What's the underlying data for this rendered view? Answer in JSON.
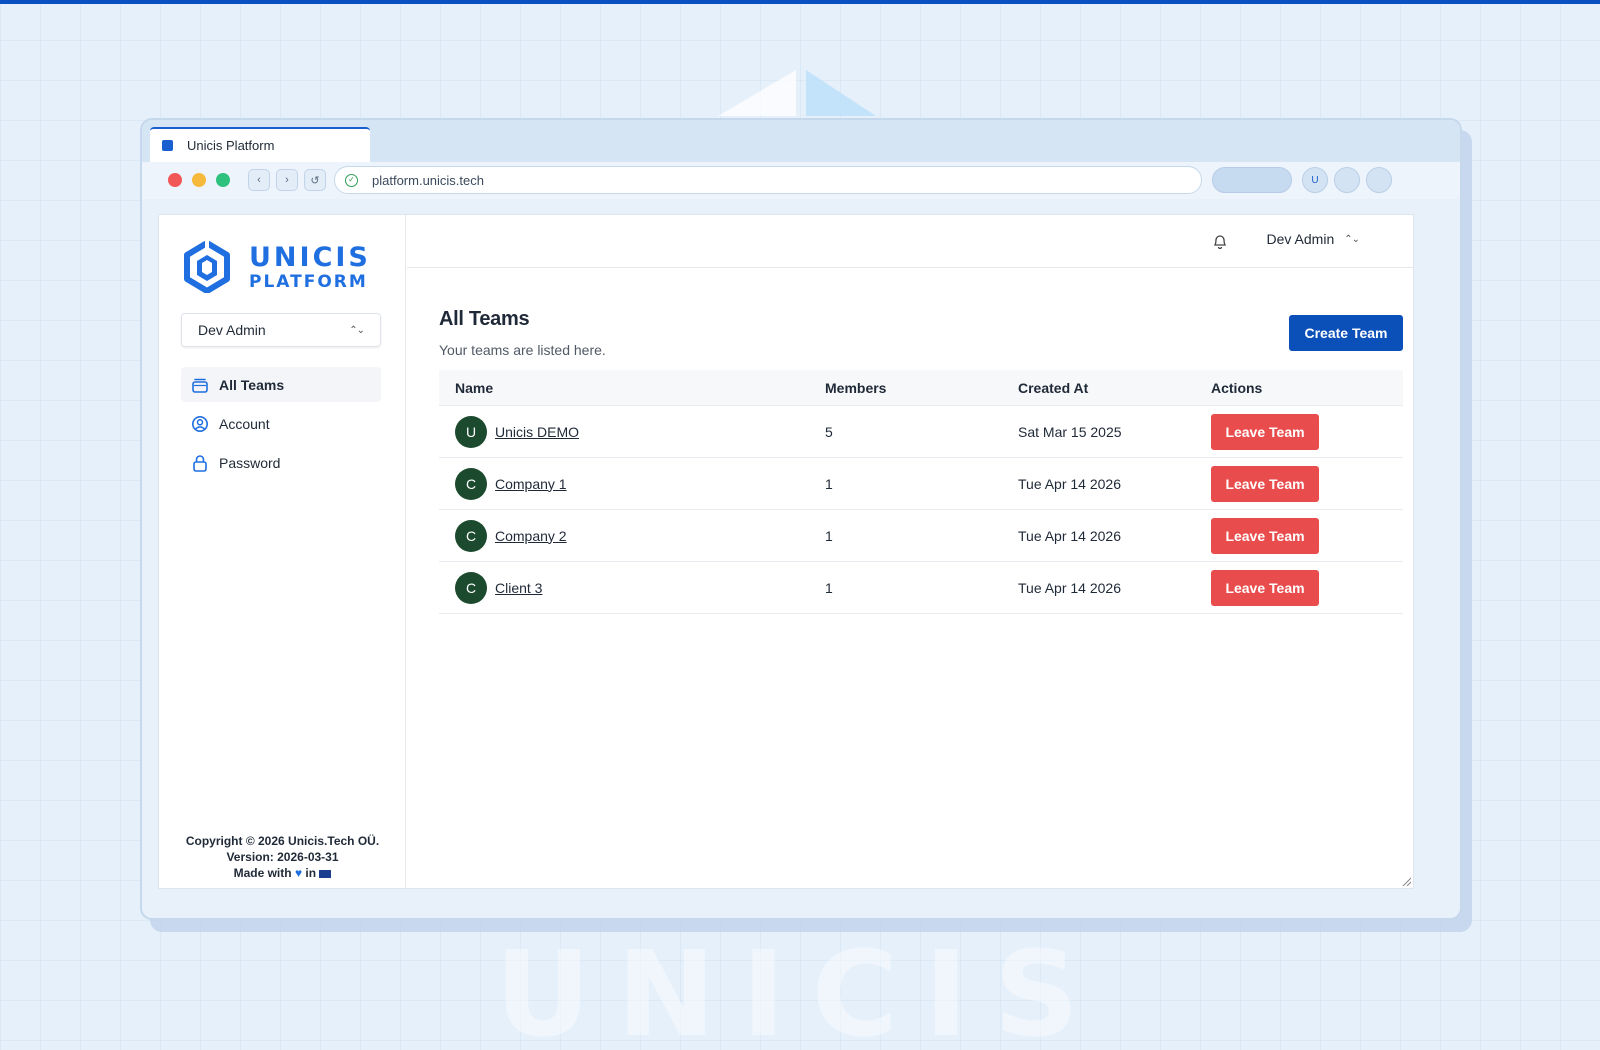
{
  "browser": {
    "tab_title": "Unicis Platform",
    "url": "platform.unicis.tech",
    "profile_initial": "U"
  },
  "watermark": "UNICIS",
  "sidebar": {
    "logo_line1": "UNICIS",
    "logo_line2": "PLATFORM",
    "user_select": "Dev Admin",
    "nav": [
      {
        "label": "All Teams",
        "icon": "teams-icon",
        "active": true
      },
      {
        "label": "Account",
        "icon": "user-circle-icon",
        "active": false
      },
      {
        "label": "Password",
        "icon": "lock-icon",
        "active": false
      }
    ],
    "footer": {
      "copyright": "Copyright © 2026 Unicis.Tech OÜ.",
      "version": "Version: 2026-03-31",
      "made_with_prefix": "Made with ",
      "made_with_mid": " in "
    }
  },
  "header": {
    "user": "Dev Admin"
  },
  "page": {
    "title": "All Teams",
    "subtitle": "Your teams are listed here.",
    "create_button": "Create Team"
  },
  "table": {
    "columns": [
      "Name",
      "Members",
      "Created At",
      "Actions"
    ],
    "rows": [
      {
        "initial": "U",
        "name": "Unicis DEMO",
        "members": "5",
        "created": "Sat Mar 15 2025",
        "action": "Leave Team"
      },
      {
        "initial": "C",
        "name": "Company 1",
        "members": "1",
        "created": "Tue Apr 14 2026",
        "action": "Leave Team"
      },
      {
        "initial": "C",
        "name": "Company 2",
        "members": "1",
        "created": "Tue Apr 14 2026",
        "action": "Leave Team"
      },
      {
        "initial": "C",
        "name": "Client 3",
        "members": "1",
        "created": "Tue Apr 14 2026",
        "action": "Leave Team"
      }
    ]
  },
  "colors": {
    "brand": "#1f6fe0",
    "primary_button": "#0b4fb8",
    "danger_button": "#e94c4c",
    "avatar": "#1c4a2e"
  }
}
